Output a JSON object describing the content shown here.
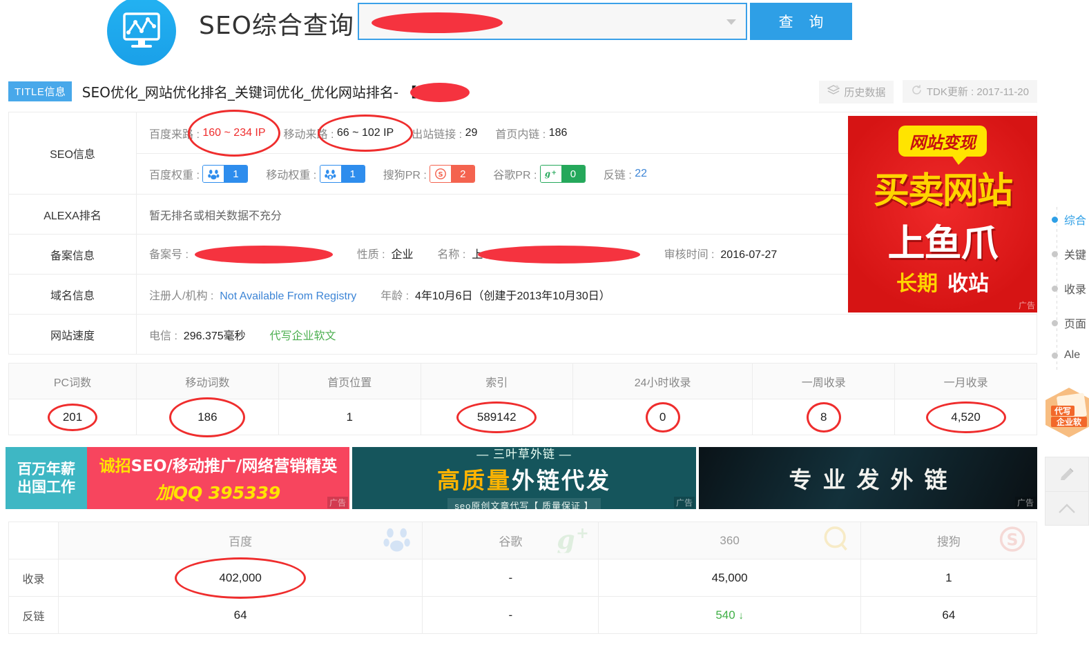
{
  "header": {
    "logo_icon": "monitor-chart-icon",
    "site_title": "SEO综合查询",
    "search_placeholder": "",
    "search_value": "",
    "dropdown_icon": "chevron-down-icon",
    "query_button": "查 询"
  },
  "titlebar": {
    "badge": "TITLE信息",
    "title": "SEO优化_网站优化排名_关键词优化_优化网站排名- 【",
    "history_chip": {
      "icon": "layers-icon",
      "label": "历史数据"
    },
    "tdk_chip": {
      "icon": "refresh-icon",
      "label": "TDK更新 : 2017-11-20"
    }
  },
  "info_rows": [
    {
      "label": "SEO信息",
      "line1": {
        "baidu_from_key": "百度来路 :",
        "baidu_from_val": "160 ~ 234 IP",
        "mobile_from_key": "移动来路 :",
        "mobile_from_val": "66 ~ 102 IP",
        "outlinks_key": "出站链接 :",
        "outlinks_val": "29",
        "homelinks_key": "首页内链 :",
        "homelinks_val": "186"
      },
      "line2": {
        "baidu_weight_key": "百度权重 :",
        "baidu_weight_val": "1",
        "mobile_weight_key": "移动权重 :",
        "mobile_weight_val": "1",
        "sogou_pr_key": "搜狗PR :",
        "sogou_pr_val": "2",
        "google_pr_key": "谷歌PR :",
        "google_pr_val": "0",
        "backlink_key": "反链 :",
        "backlink_val": "22"
      }
    },
    {
      "label": "ALEXA排名",
      "text": "暂无排名或相关数据不充分"
    },
    {
      "label": "备案信息",
      "icp_key": "备案号 :",
      "icp_val": "",
      "nature_key": "性质 :",
      "nature_val": "企业",
      "name_key": "名称 :",
      "name_val": "上",
      "audit_key": "审核时间 :",
      "audit_val": "2016-07-27"
    },
    {
      "label": "域名信息",
      "registrant_key": "注册人/机构 :",
      "registrant_val": "Not Available From Registry",
      "age_key": "年龄 :",
      "age_val": "4年10月6日（创建于2013年10月30日）"
    },
    {
      "label": "网站速度",
      "speed_key": "电信 :",
      "speed_val": "296.375毫秒",
      "promo_link": "代写企业软文"
    }
  ],
  "stats_table": {
    "headers": [
      "PC词数",
      "移动词数",
      "首页位置",
      "索引",
      "24小时收录",
      "一周收录",
      "一月收录"
    ],
    "values": [
      "201",
      "186",
      "1",
      "589142",
      "0",
      "8",
      "4,520"
    ]
  },
  "ads": [
    {
      "name": "recruit-ad",
      "left_line1": "百万年薪",
      "left_line2": "出国工作",
      "line1_a": "诚招",
      "line1_b": "SEO/移动推广/网络营销精英",
      "line2": "加QQ 395339",
      "tag": "广告"
    },
    {
      "name": "backlink-ad",
      "line0": "— 三叶草外链 —",
      "line1_a": "高质量",
      "line1_b": "外链代发",
      "line2": "seo原创文章代写【 质量保证 】",
      "tag": "广告"
    },
    {
      "name": "pro-backlink-ad",
      "line1": "专业发外链",
      "tag": "广告"
    }
  ],
  "red_ad": {
    "bubble": "网站变现",
    "line1": "买卖网站",
    "line2": "上鱼爪",
    "line3_a": "长期",
    "line3_b": "收站",
    "tag": "广告"
  },
  "engine_table": {
    "row_labels": [
      "收录",
      "反链"
    ],
    "engines": [
      {
        "name": "百度",
        "icon": "baidu-paw-icon",
        "color": "#a8c8f0"
      },
      {
        "name": "谷歌",
        "icon": "google-plus-icon",
        "color": "#bfe0bf"
      },
      {
        "name": "360",
        "icon": "so360-magnifier-icon",
        "color": "#f5d98a"
      },
      {
        "name": "搜狗",
        "icon": "sogou-s-icon",
        "color": "#f0b3ac"
      }
    ],
    "rows": [
      {
        "label": "收录",
        "cells": [
          "402,000",
          "-",
          "45,000",
          "1"
        ]
      },
      {
        "label": "反链",
        "cells": [
          "64",
          "-",
          "540",
          "64"
        ]
      }
    ],
    "backlink_360_trend": "down"
  },
  "sidebar_nav": [
    {
      "label": "综合",
      "active": true
    },
    {
      "label": "关键",
      "active": false
    },
    {
      "label": "收录",
      "active": false
    },
    {
      "label": "页面",
      "active": false
    },
    {
      "label": "Ale",
      "active": false
    }
  ],
  "float_ad": {
    "line1": "代写",
    "line2": "企业软"
  },
  "float_tools": [
    {
      "name": "edit-pencil-icon"
    },
    {
      "name": "back-to-top-icon"
    }
  ],
  "colors": {
    "accent": "#2e9fe6",
    "annotation": "#ef2d2d",
    "link": "#3d85d6",
    "green": "#4caf50"
  }
}
